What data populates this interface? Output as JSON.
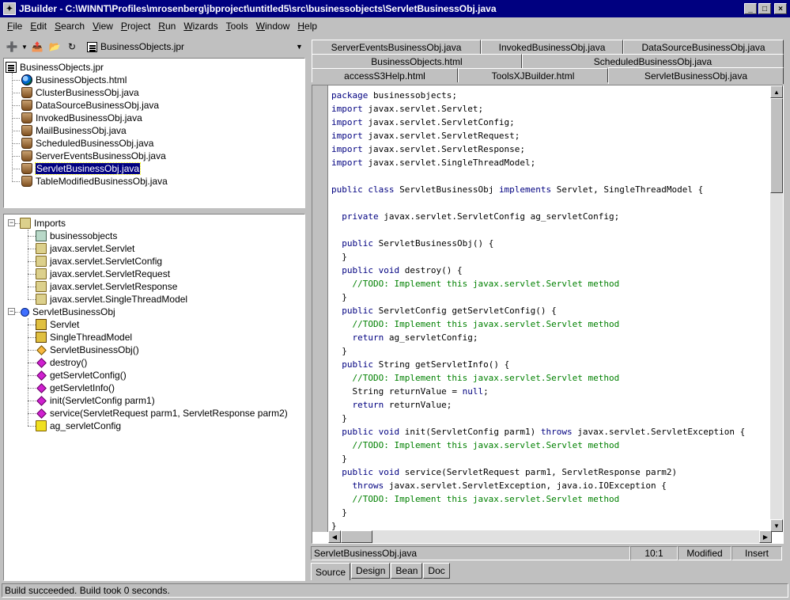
{
  "window": {
    "title": "JBuilder - C:\\WINNT\\Profiles\\mrosenberg\\jbproject\\untitled5\\src\\businessobjects\\ServletBusinessObj.java"
  },
  "menu": [
    {
      "label": "File",
      "u": "F",
      "rest": "ile"
    },
    {
      "label": "Edit",
      "u": "E",
      "rest": "dit"
    },
    {
      "label": "Search",
      "u": "S",
      "rest": "earch"
    },
    {
      "label": "View",
      "u": "V",
      "rest": "iew"
    },
    {
      "label": "Project",
      "u": "P",
      "rest": "roject"
    },
    {
      "label": "Run",
      "u": "R",
      "rest": "un"
    },
    {
      "label": "Wizards",
      "u": "W",
      "rest": "izards"
    },
    {
      "label": "Tools",
      "u": "T",
      "rest": "ools"
    },
    {
      "label": "Window",
      "u": "W",
      "rest": "indow"
    },
    {
      "label": "Help",
      "u": "H",
      "rest": "elp"
    }
  ],
  "project_selector": {
    "value": "BusinessObjects.jpr"
  },
  "project_tree": {
    "root": "BusinessObjects.jpr",
    "items": [
      {
        "label": "BusinessObjects.html",
        "icon": "globe-icon"
      },
      {
        "label": "ClusterBusinessObj.java",
        "icon": "java-file-icon"
      },
      {
        "label": "DataSourceBusinessObj.java",
        "icon": "java-file-icon"
      },
      {
        "label": "InvokedBusinessObj.java",
        "icon": "java-file-icon"
      },
      {
        "label": "MailBusinessObj.java",
        "icon": "java-file-icon"
      },
      {
        "label": "ScheduledBusinessObj.java",
        "icon": "java-file-icon"
      },
      {
        "label": "ServerEventsBusinessObj.java",
        "icon": "java-file-icon"
      },
      {
        "label": "ServletBusinessObj.java",
        "icon": "java-file-icon",
        "selected": true
      },
      {
        "label": "TableModifiedBusinessObj.java",
        "icon": "java-file-icon"
      }
    ]
  },
  "structure_tree": {
    "imports_label": "Imports",
    "imports": [
      "businessobjects",
      "javax.servlet.Servlet",
      "javax.servlet.ServletConfig",
      "javax.servlet.ServletRequest",
      "javax.servlet.ServletResponse",
      "javax.servlet.SingleThreadModel"
    ],
    "class_label": "ServletBusinessObj",
    "members": [
      {
        "label": "Servlet",
        "kind": "interface"
      },
      {
        "label": "SingleThreadModel",
        "kind": "interface"
      },
      {
        "label": "ServletBusinessObj()",
        "kind": "constructor"
      },
      {
        "label": "destroy()",
        "kind": "method"
      },
      {
        "label": "getServletConfig()",
        "kind": "method"
      },
      {
        "label": "getServletInfo()",
        "kind": "method"
      },
      {
        "label": "init(ServletConfig parm1)",
        "kind": "method"
      },
      {
        "label": "service(ServletRequest parm1, ServletResponse parm2)",
        "kind": "method"
      },
      {
        "label": "ag_servletConfig",
        "kind": "field"
      }
    ]
  },
  "editor_tabs": {
    "row1": [
      "ServerEventsBusinessObj.java",
      "InvokedBusinessObj.java",
      "DataSourceBusinessObj.java"
    ],
    "row2": [
      "BusinessObjects.html",
      "ScheduledBusinessObj.java"
    ],
    "row3": [
      "accessS3Help.html",
      "ToolsXJBuilder.html",
      "ServletBusinessObj.java"
    ]
  },
  "code_lines": [
    [
      [
        "kw",
        "package"
      ],
      [
        "t",
        " businessobjects;"
      ]
    ],
    [
      [
        "kw",
        "import"
      ],
      [
        "t",
        " javax.servlet.Servlet;"
      ]
    ],
    [
      [
        "kw",
        "import"
      ],
      [
        "t",
        " javax.servlet.ServletConfig;"
      ]
    ],
    [
      [
        "kw",
        "import"
      ],
      [
        "t",
        " javax.servlet.ServletRequest;"
      ]
    ],
    [
      [
        "kw",
        "import"
      ],
      [
        "t",
        " javax.servlet.ServletResponse;"
      ]
    ],
    [
      [
        "kw",
        "import"
      ],
      [
        "t",
        " javax.servlet.SingleThreadModel;"
      ]
    ],
    [],
    [
      [
        "kw",
        "public class"
      ],
      [
        "t",
        " ServletBusinessObj "
      ],
      [
        "kw",
        "implements"
      ],
      [
        "t",
        " Servlet, SingleThreadModel {"
      ]
    ],
    [],
    [
      [
        "t",
        "  "
      ],
      [
        "kw",
        "private"
      ],
      [
        "t",
        " javax.servlet.ServletConfig ag_servletConfig;"
      ]
    ],
    [],
    [
      [
        "t",
        "  "
      ],
      [
        "kw",
        "public"
      ],
      [
        "t",
        " ServletBusinessObj() {"
      ]
    ],
    [
      [
        "t",
        "  }"
      ]
    ],
    [
      [
        "t",
        "  "
      ],
      [
        "kw",
        "public void"
      ],
      [
        "t",
        " destroy() {"
      ]
    ],
    [
      [
        "t",
        "    "
      ],
      [
        "cm",
        "//TODO: Implement this javax.servlet.Servlet method"
      ]
    ],
    [
      [
        "t",
        "  }"
      ]
    ],
    [
      [
        "t",
        "  "
      ],
      [
        "kw",
        "public"
      ],
      [
        "t",
        " ServletConfig getServletConfig() {"
      ]
    ],
    [
      [
        "t",
        "    "
      ],
      [
        "cm",
        "//TODO: Implement this javax.servlet.Servlet method"
      ]
    ],
    [
      [
        "t",
        "    "
      ],
      [
        "kw",
        "return"
      ],
      [
        "t",
        " ag_servletConfig;"
      ]
    ],
    [
      [
        "t",
        "  }"
      ]
    ],
    [
      [
        "t",
        "  "
      ],
      [
        "kw",
        "public"
      ],
      [
        "t",
        " String getServletInfo() {"
      ]
    ],
    [
      [
        "t",
        "    "
      ],
      [
        "cm",
        "//TODO: Implement this javax.servlet.Servlet method"
      ]
    ],
    [
      [
        "t",
        "    String returnValue = "
      ],
      [
        "kw",
        "null"
      ],
      [
        "t",
        ";"
      ]
    ],
    [
      [
        "t",
        "    "
      ],
      [
        "kw",
        "return"
      ],
      [
        "t",
        " returnValue;"
      ]
    ],
    [
      [
        "t",
        "  }"
      ]
    ],
    [
      [
        "t",
        "  "
      ],
      [
        "kw",
        "public void"
      ],
      [
        "t",
        " init(ServletConfig parm1) "
      ],
      [
        "kw",
        "throws"
      ],
      [
        "t",
        " javax.servlet.ServletException {"
      ]
    ],
    [
      [
        "t",
        "    "
      ],
      [
        "cm",
        "//TODO: Implement this javax.servlet.Servlet method"
      ]
    ],
    [
      [
        "t",
        "  }"
      ]
    ],
    [
      [
        "t",
        "  "
      ],
      [
        "kw",
        "public void"
      ],
      [
        "t",
        " service(ServletRequest parm1, ServletResponse parm2)"
      ]
    ],
    [
      [
        "t",
        "    "
      ],
      [
        "kw",
        "throws"
      ],
      [
        "t",
        " javax.servlet.ServletException, java.io.IOException {"
      ]
    ],
    [
      [
        "t",
        "    "
      ],
      [
        "cm",
        "//TODO: Implement this javax.servlet.Servlet method"
      ]
    ],
    [
      [
        "t",
        "  }"
      ]
    ],
    [
      [
        "t",
        "}"
      ]
    ]
  ],
  "status": {
    "file": "ServletBusinessObj.java",
    "position": "10:1",
    "modified": "Modified",
    "mode": "Insert"
  },
  "bottom_tabs": [
    "Source",
    "Design",
    "Bean",
    "Doc"
  ],
  "main_status": "Build succeeded.  Build took 0 seconds."
}
